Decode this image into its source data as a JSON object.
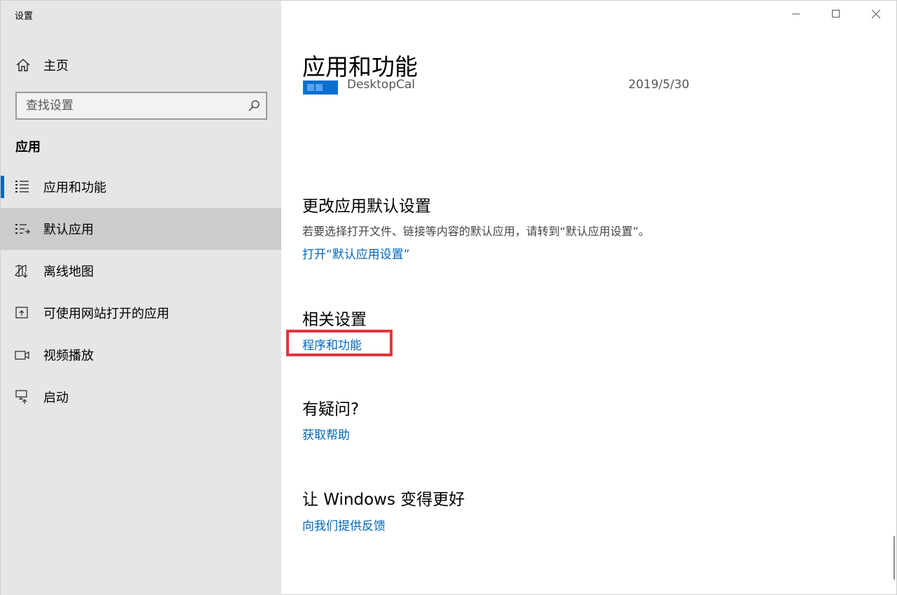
{
  "window": {
    "title": "设置"
  },
  "sidebar": {
    "home_label": "主页",
    "search_placeholder": "查找设置",
    "section_title": "应用",
    "items": [
      {
        "label": "应用和功能",
        "icon": "apps-list-icon",
        "active": true
      },
      {
        "label": "默认应用",
        "icon": "default-apps-icon",
        "hovered": true
      },
      {
        "label": "离线地图",
        "icon": "offline-map-icon"
      },
      {
        "label": "可使用网站打开的应用",
        "icon": "apps-for-websites-icon"
      },
      {
        "label": "视频播放",
        "icon": "video-playback-icon"
      },
      {
        "label": "启动",
        "icon": "startup-icon"
      }
    ]
  },
  "content": {
    "page_title": "应用和功能",
    "partial_app": {
      "name": "DesktopCal",
      "date": "2019/5/30"
    },
    "default_settings": {
      "title": "更改应用默认设置",
      "description": "若要选择打开文件、链接等内容的默认应用，请转到“默认应用设置”。",
      "link": "打开“默认应用设置”"
    },
    "related": {
      "title": "相关设置",
      "link": "程序和功能"
    },
    "help": {
      "title": "有疑问?",
      "link": "获取帮助"
    },
    "feedback": {
      "title": "让 Windows 变得更好",
      "link": "向我们提供反馈"
    }
  },
  "colors": {
    "accent": "#0067b8",
    "sidebar_bg": "#e6e6e6",
    "highlight": "#e8333a"
  }
}
